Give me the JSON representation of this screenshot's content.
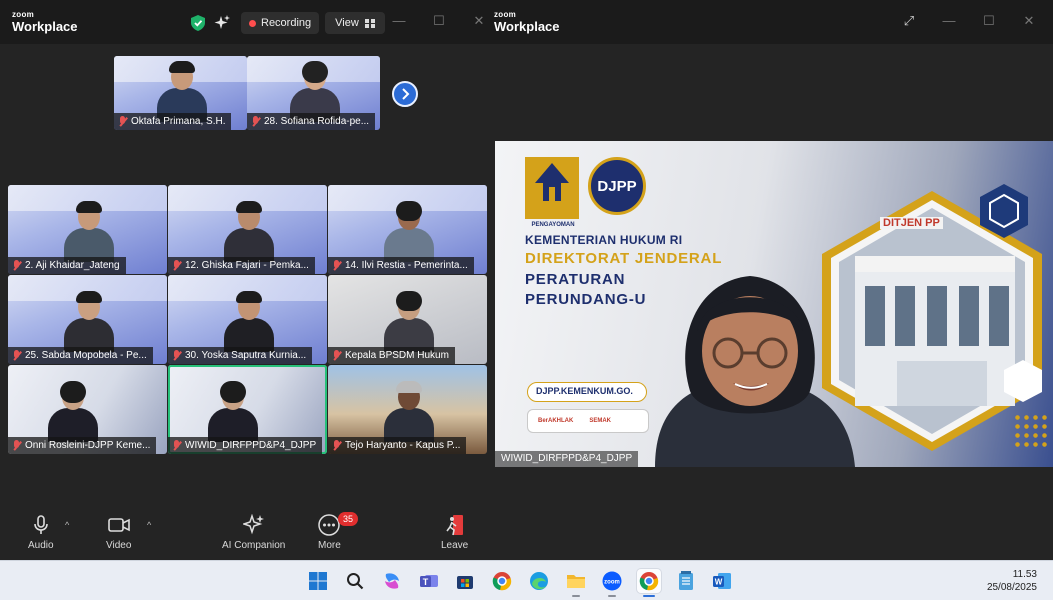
{
  "left_window": {
    "brand_small": "zoom",
    "brand_large": "Workplace",
    "recording_label": "Recording",
    "view_label": "View"
  },
  "top_strip": [
    {
      "name": "Oktafa Primana, S.H."
    },
    {
      "name": "28. Sofiana Rofida-pe..."
    }
  ],
  "grid": [
    {
      "name": "2. Aji Khaidar_Jateng"
    },
    {
      "name": "12. Ghiska Fajari - Pemka..."
    },
    {
      "name": "14. Ilvi Restia - Pemerinta..."
    },
    {
      "name": "25. Sabda Mopobela - Pe..."
    },
    {
      "name": "30. Yoska Saputra Kurnia..."
    },
    {
      "name": "Kepala BPSDM Hukum"
    },
    {
      "name": "Onni Rosleini-DJPP Keme..."
    },
    {
      "name": "WIWID_DIRFPPD&P4_DJPP"
    },
    {
      "name": "Tejo Haryanto - Kapus P..."
    }
  ],
  "toolbar": {
    "audio": "Audio",
    "video": "Video",
    "ai_companion": "AI Companion",
    "more": "More",
    "more_badge": "35",
    "leave": "Leave"
  },
  "right_window": {
    "brand_small": "zoom",
    "brand_large": "Workplace",
    "shared_screen": {
      "djpp_logo": "DJPP",
      "pengayoman": "PENGAYOMAN",
      "line1": "KEMENTERIAN HUKUM RI",
      "line2": "DIREKTORAT JENDERAL",
      "line3": "PERATURAN",
      "line4": "PERUNDANG-U",
      "url": "DJPP.KEMENKUM.GO.",
      "tag1": "BerAKHLAK",
      "tag2": "SEMAK",
      "building_sign": "DITJEN PP"
    },
    "speaker_name": "WIWID_DIRFPPD&P4_DJPP"
  },
  "taskbar": {
    "time": "11.53",
    "date": "25/08/2025",
    "apps": [
      "windows-start",
      "search",
      "copilot",
      "teams",
      "store",
      "chrome",
      "edge",
      "file-explorer",
      "zoom",
      "chrome-active",
      "notepad",
      "word"
    ]
  },
  "colors": {
    "recording_red": "#ff4e4e",
    "active_speaker_green": "#27c07a",
    "next_button_blue": "#2b6bd6",
    "djpp_navy": "#1e2f6e",
    "djpp_gold": "#d4a21a"
  }
}
